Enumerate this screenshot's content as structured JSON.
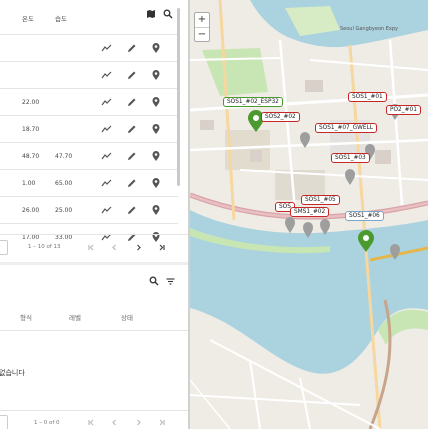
{
  "sensor_table": {
    "col_temp": "온도",
    "col_humidity": "습도",
    "rows": [
      {
        "temp": "",
        "humidity": ""
      },
      {
        "temp": "",
        "humidity": ""
      },
      {
        "temp": "22.00",
        "humidity": ""
      },
      {
        "temp": "18.70",
        "humidity": ""
      },
      {
        "temp": "48.70",
        "humidity": "47.70"
      },
      {
        "temp": "1.00",
        "humidity": "65.00"
      },
      {
        "temp": "26.00",
        "humidity": "25.00"
      },
      {
        "temp": "17.00",
        "humidity": "33.00"
      }
    ],
    "pager": {
      "range": "1 – 10 of 13"
    }
  },
  "event_table": {
    "col_type": "형식",
    "col_level": "레벨",
    "col_status": "상태",
    "empty_text": "없습니다",
    "pager": {
      "range": "1 – 0 of 0"
    }
  },
  "map": {
    "zoom_in": "+",
    "zoom_out": "−",
    "markers": [
      {
        "label": "SOS1_#01",
        "style": "red"
      },
      {
        "label": "SOS1_#02_ESP32",
        "style": "green"
      },
      {
        "label": "PO2_#01",
        "style": "red"
      },
      {
        "label": "SOS2_#02",
        "style": "red"
      },
      {
        "label": "SOS1_#07_GWELL",
        "style": "red"
      },
      {
        "label": "SOS1_#03",
        "style": "red"
      },
      {
        "label": "SOS1_#05",
        "style": "red"
      },
      {
        "label": "SOS",
        "style": "red"
      },
      {
        "label": "SMS1_#02",
        "style": "red"
      },
      {
        "label": "SOS1_#06",
        "style": "blue"
      }
    ],
    "labels": [
      "Seoul Gangbyeon Expy"
    ],
    "colors": {
      "marker_red": "#c62828",
      "marker_green": "#4a9a2e",
      "marker_blue": "#7aa7c7",
      "river": "#aad3df",
      "park": "#c8e6b4"
    }
  }
}
